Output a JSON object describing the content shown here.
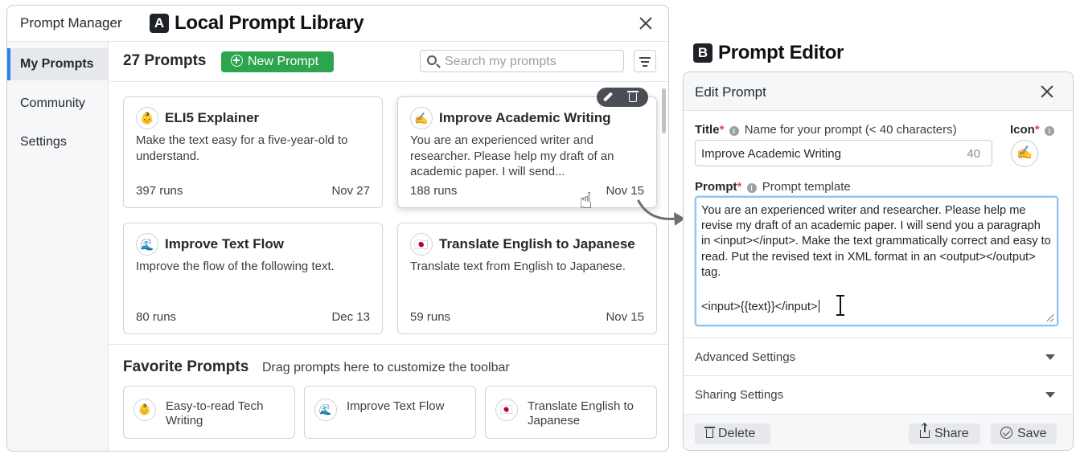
{
  "panel_a": {
    "badge": "A",
    "app_name": "Prompt Manager",
    "heading": "Local Prompt Library",
    "sidebar": [
      {
        "label": "My Prompts"
      },
      {
        "label": "Community"
      },
      {
        "label": "Settings"
      }
    ],
    "prompt_count_title": "27 Prompts",
    "new_prompt_label": "New Prompt",
    "search_placeholder": "Search my prompts",
    "cards": [
      {
        "icon": "👶",
        "title": "ELI5 Explainer",
        "description": "Make the text easy for a five-year-old to understand.",
        "runs": "397 runs",
        "date": "Nov 27"
      },
      {
        "icon": "✍️",
        "title": "Improve Academic Writing",
        "description": "You are an experienced writer and researcher. Please help my draft of an academic paper. I will send...",
        "runs": "188 runs",
        "date": "Nov 15"
      },
      {
        "icon": "🌊",
        "title": "Improve Text Flow",
        "description": "Improve the flow of the following text.",
        "runs": "80 runs",
        "date": "Dec 13"
      },
      {
        "icon": "🇯🇵",
        "title": "Translate English to Japanese",
        "description": "Translate text from English to Japanese.",
        "runs": "59 runs",
        "date": "Nov 15"
      }
    ],
    "favorites_title": "Favorite Prompts",
    "favorites_hint": "Drag prompts here to customize the toolbar",
    "favorites": [
      {
        "icon": "👶",
        "label": "Easy-to-read Tech Writing"
      },
      {
        "icon": "🌊",
        "label": "Improve Text Flow"
      },
      {
        "icon": "🇯🇵",
        "label": "Translate English to Japanese"
      }
    ]
  },
  "panel_b": {
    "badge": "B",
    "heading": "Prompt Editor",
    "window_title": "Edit Prompt",
    "title_label": "Title",
    "required_mark": "*",
    "info_glyph": "i",
    "title_hint": "Name for your prompt (< 40 characters)",
    "title_value": "Improve Academic Writing",
    "title_remaining": "40",
    "icon_label": "Icon",
    "icon_value": "✍️",
    "prompt_label": "Prompt",
    "prompt_hint": "Prompt template",
    "prompt_text": "You are an experienced writer and researcher. Please help me revise my draft of an academic paper. I will send you a paragraph in <input></input>. Make the text grammatically correct and easy to read. Put the revised text in XML format in an <output></output> tag.",
    "prompt_input_line": "<input>{{text}}</input>",
    "advanced_settings": "Advanced Settings",
    "sharing_settings": "Sharing Settings",
    "delete_label": "Delete",
    "share_label": "Share",
    "save_label": "Save"
  },
  "colors": {
    "accent_green": "#2da44e",
    "active_blue": "#2f80ed",
    "focus_blue": "#90c4ee",
    "required_red": "#e5484d"
  }
}
